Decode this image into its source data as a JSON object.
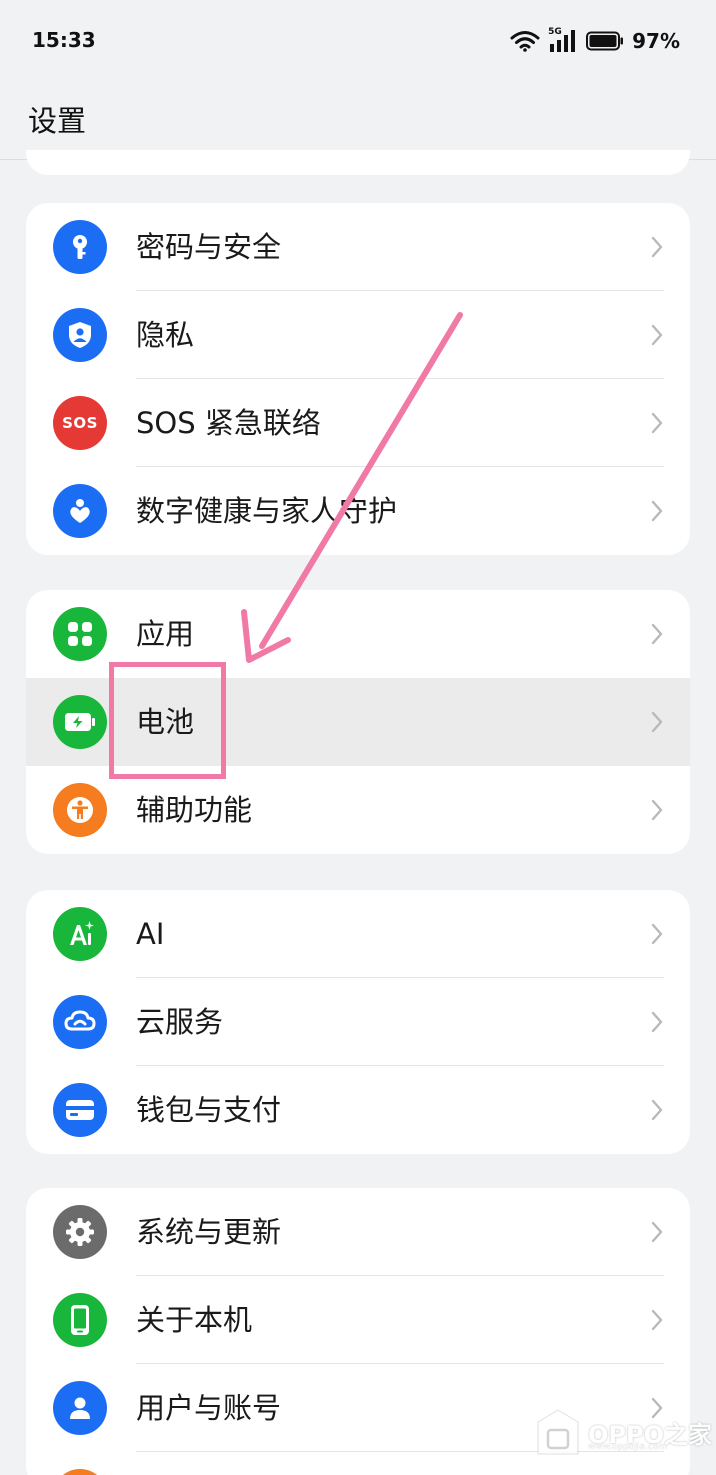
{
  "status_bar": {
    "time": "15:33",
    "network": "5G",
    "battery_percent": "97%"
  },
  "header": {
    "title": "设置"
  },
  "groups": [
    {
      "items": [
        {
          "label": "密码与安全",
          "icon": "key-icon",
          "color": "#1b6ef3"
        },
        {
          "label": "隐私",
          "icon": "privacy-shield-icon",
          "color": "#1b6ef3"
        },
        {
          "label": "SOS 紧急联络",
          "icon": "sos-icon",
          "icon_text": "SOS",
          "color": "#e53935"
        },
        {
          "label": "数字健康与家人守护",
          "icon": "digital-wellbeing-icon",
          "color": "#1b6ef3"
        }
      ]
    },
    {
      "items": [
        {
          "label": "应用",
          "icon": "apps-grid-icon",
          "color": "#18b63a"
        },
        {
          "label": "电池",
          "icon": "battery-icon",
          "color": "#18b63a",
          "highlighted": true
        },
        {
          "label": "辅助功能",
          "icon": "accessibility-icon",
          "color": "#f57c1f"
        }
      ]
    },
    {
      "items": [
        {
          "label": "AI",
          "icon": "ai-sparkle-icon",
          "color": "#18b63a"
        },
        {
          "label": "云服务",
          "icon": "cloud-icon",
          "color": "#1b6ef3"
        },
        {
          "label": "钱包与支付",
          "icon": "wallet-card-icon",
          "color": "#1b6ef3"
        }
      ]
    },
    {
      "items": [
        {
          "label": "系统与更新",
          "icon": "gear-icon",
          "color": "#6b6b6b"
        },
        {
          "label": "关于本机",
          "icon": "phone-icon",
          "color": "#18b63a"
        },
        {
          "label": "用户与账号",
          "icon": "user-icon",
          "color": "#1b6ef3"
        }
      ]
    }
  ],
  "annotation": {
    "color": "#f07aa5",
    "target": "电池"
  },
  "watermark": {
    "text": "OPPO之家",
    "subtext": "www.oppojia.com"
  }
}
